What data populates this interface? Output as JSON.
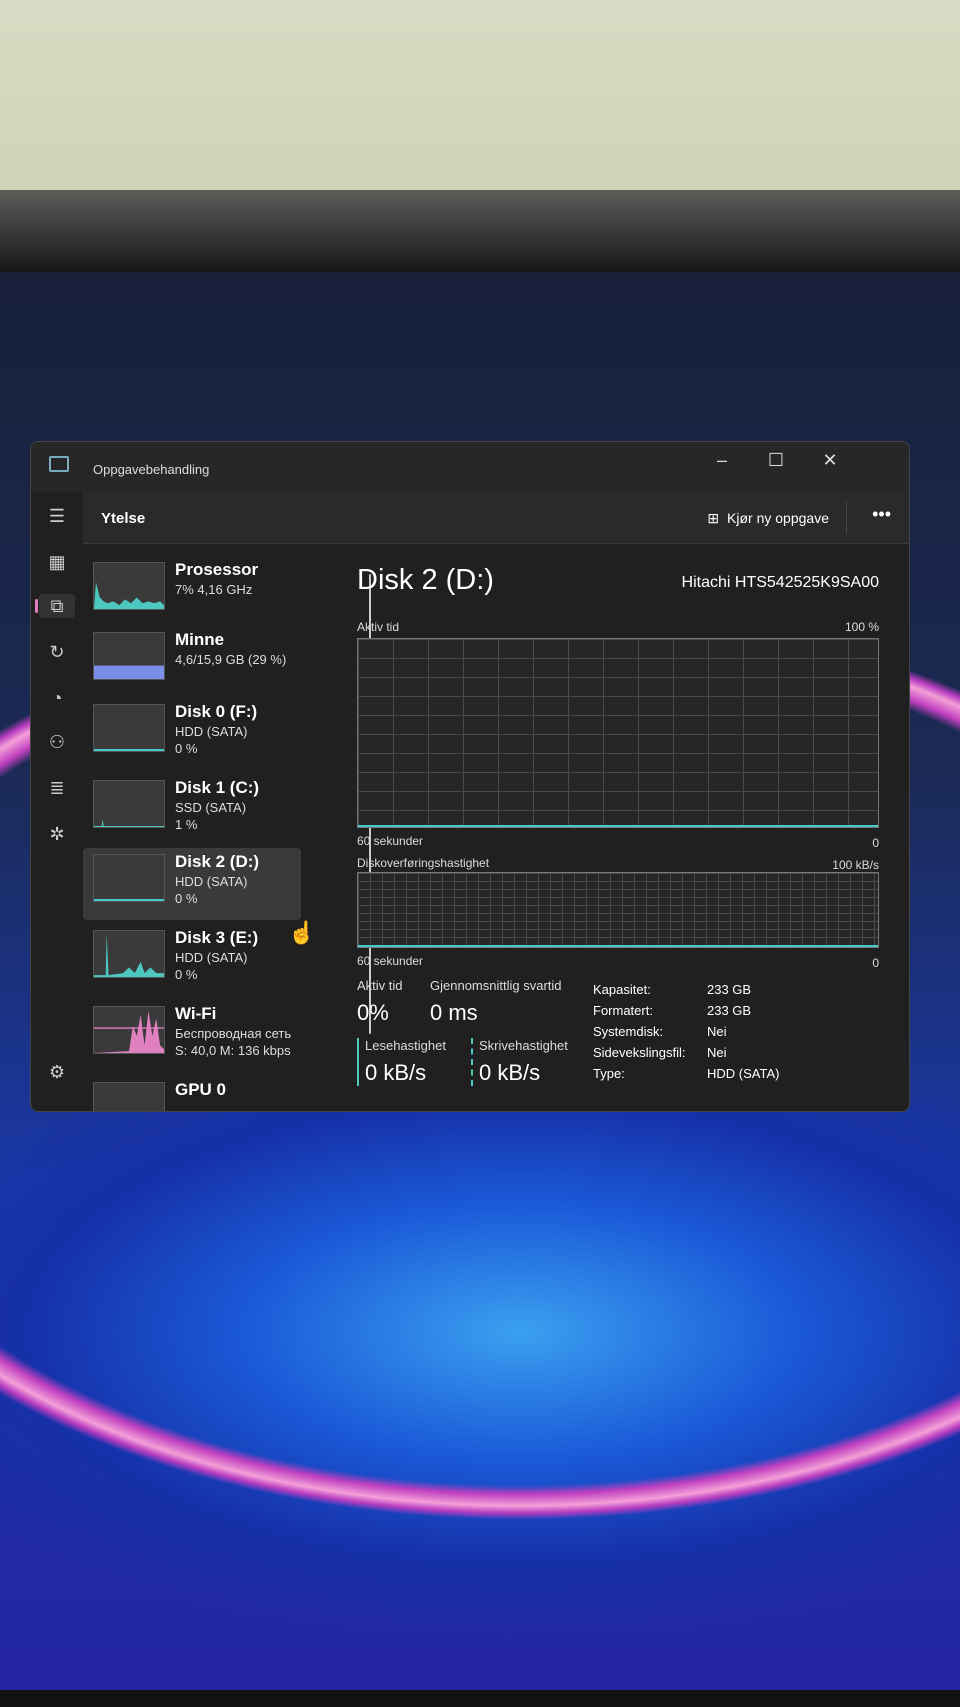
{
  "window": {
    "title": "Oppgavebehandling",
    "minimize": "–",
    "maximize": "☐",
    "close": "✕"
  },
  "header": {
    "title": "Ytelse",
    "new_task": "Kjør ny oppgave",
    "more": "•••"
  },
  "rail": [
    "menu-icon",
    "processes-icon",
    "performance-icon",
    "history-icon",
    "startup-icon",
    "users-icon",
    "details-icon",
    "services-icon",
    "settings-icon"
  ],
  "list": [
    {
      "name": "Prosessor",
      "sub1": "7% 4,16 GHz",
      "sub2": ""
    },
    {
      "name": "Minne",
      "sub1": "4,6/15,9 GB (29 %)",
      "sub2": ""
    },
    {
      "name": "Disk 0 (F:)",
      "sub1": "HDD (SATA)",
      "sub2": "0 %"
    },
    {
      "name": "Disk 1 (C:)",
      "sub1": "SSD (SATA)",
      "sub2": "1 %"
    },
    {
      "name": "Disk 2 (D:)",
      "sub1": "HDD (SATA)",
      "sub2": "0 %"
    },
    {
      "name": "Disk 3 (E:)",
      "sub1": "HDD (SATA)",
      "sub2": "0 %"
    },
    {
      "name": "Wi-Fi",
      "sub1": "Беспроводная сеть",
      "sub2": "S: 40,0 M: 136 kbps"
    },
    {
      "name": "GPU 0",
      "sub1": "",
      "sub2": ""
    }
  ],
  "detail": {
    "title": "Disk 2 (D:)",
    "model": "Hitachi HTS542525K9SA00",
    "chart1": {
      "label": "Aktiv tid",
      "max": "100 %",
      "xlabel": "60 sekunder",
      "min": "0"
    },
    "chart2": {
      "label": "Diskoverføringshastighet",
      "max": "100 kB/s",
      "xlabel": "60 sekunder",
      "min": "0"
    },
    "stats": {
      "active_label": "Aktiv tid",
      "active": "0%",
      "resp_label": "Gjennomsnittlig svartid",
      "resp": "0 ms",
      "read_label": "Lesehastighet",
      "read": "0 kB/s",
      "write_label": "Skrivehastighet",
      "write": "0 kB/s"
    },
    "props": [
      [
        "Kapasitet:",
        "233 GB"
      ],
      [
        "Formatert:",
        "233 GB"
      ],
      [
        "Systemdisk:",
        "Nei"
      ],
      [
        "Sidevekslingsfil:",
        "Nei"
      ],
      [
        "Type:",
        "HDD (SATA)"
      ]
    ]
  },
  "colors": {
    "disk": "#4cc8c0",
    "memory": "#7a8ee8",
    "wifi": "#e080c0"
  }
}
